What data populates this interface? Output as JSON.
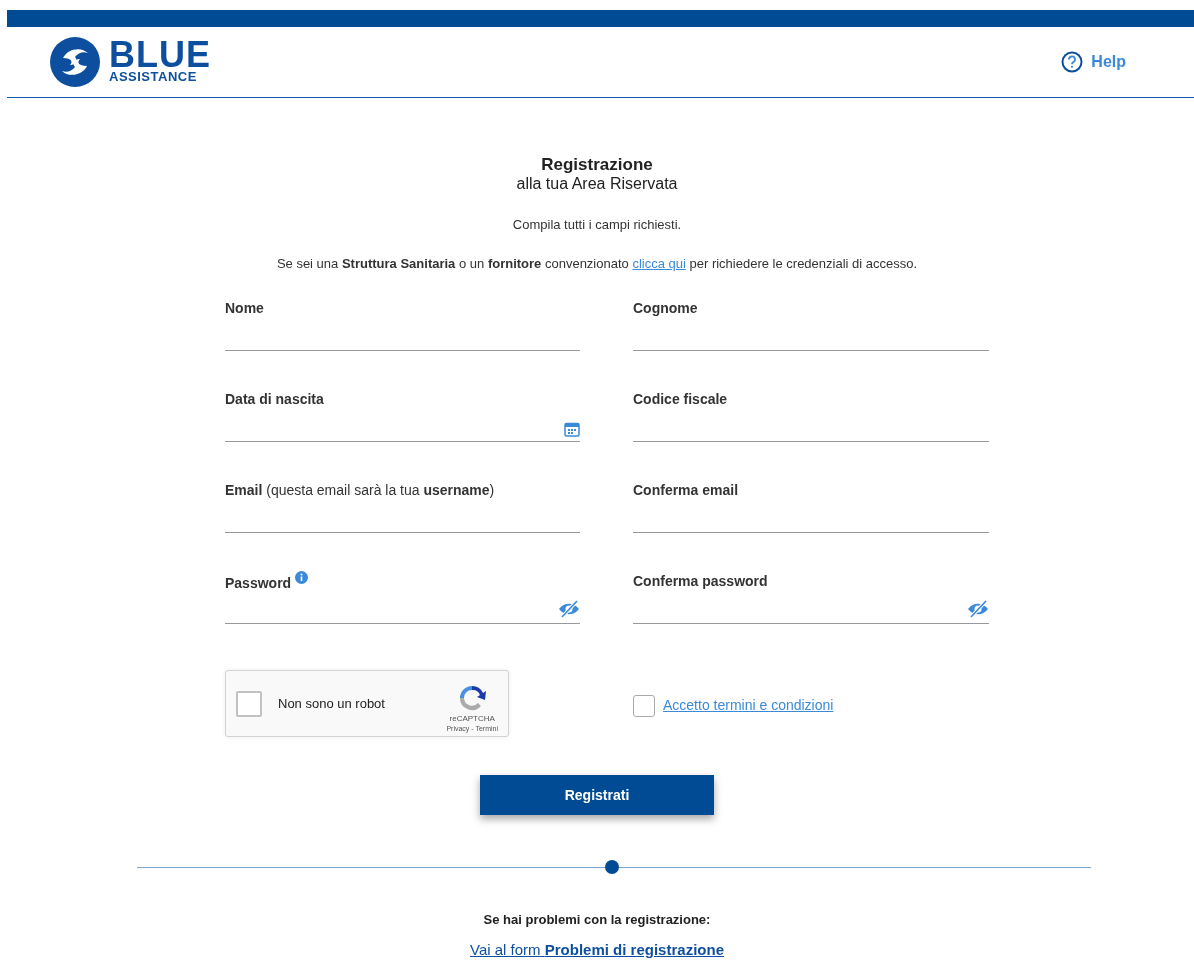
{
  "header": {
    "logo_top": "BLUE",
    "logo_bottom": "ASSISTANCE",
    "help": "Help"
  },
  "title": "Registrazione",
  "subtitle": "alla tua Area Riservata",
  "instructions": "Compila tutti i campi richiesti.",
  "notice": {
    "before": "Se sei una **Struttura Sanitaria** o un **fornitore** convenzionato",
    "link": "clicca qui",
    "after": "per richiedere le credenziali di accesso."
  },
  "fields": [
    {
      "kind": "text",
      "label": "Nome"
    },
    {
      "kind": "text",
      "label": "Cognome"
    },
    {
      "kind": "date",
      "label": "Data di nascita"
    },
    {
      "kind": "text",
      "label": "Codice fiscale"
    },
    {
      "kind": "text",
      "label": "Email",
      "note": "(questa email sarà la tua **username**)"
    },
    {
      "kind": "text",
      "label": "Conferma email"
    },
    {
      "kind": "password",
      "label": "Password",
      "info": true
    },
    {
      "kind": "password",
      "label": "Conferma password"
    }
  ],
  "captcha": {
    "label": "Non sono un robot",
    "checked": false,
    "brand": "reCAPTCHA",
    "links": "Privacy - Termini"
  },
  "terms": {
    "label": "Accetto termini e condizioni",
    "checked": false
  },
  "submit": "Registrati",
  "footer": {
    "text": "Se hai problemi con la registrazione:",
    "link": "Vai al form **Problemi di registrazione**"
  }
}
